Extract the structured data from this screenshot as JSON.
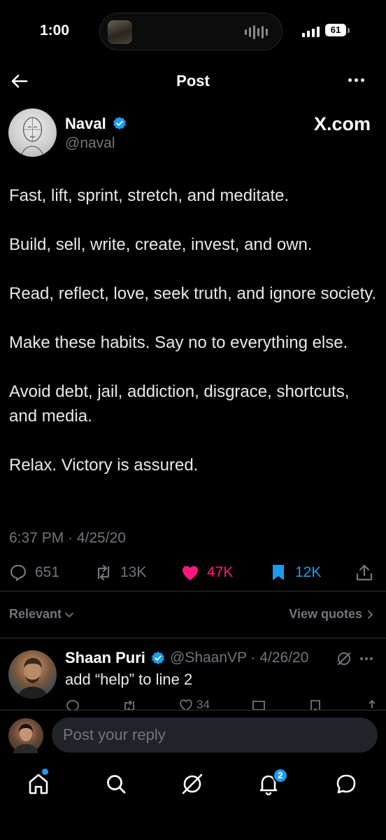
{
  "status_bar": {
    "time": "1:00",
    "battery": "61"
  },
  "header": {
    "title": "Post",
    "back_icon": "arrow-left-icon",
    "more_icon": "more-horizontal-icon"
  },
  "author": {
    "name": "Naval",
    "handle": "@naval",
    "verified": true,
    "watermark": "X.com"
  },
  "post": {
    "paragraphs": [
      "Fast, lift, sprint, stretch, and meditate.",
      "Build, sell, write, create, invest, and own.",
      "Read, reflect, love, seek truth, and ignore society.",
      "Make these habits. Say no to everything else.",
      "Avoid debt, jail, addiction, disgrace, shortcuts, and media.",
      "Relax. Victory is assured."
    ],
    "timestamp": "6:37 PM · 4/25/20"
  },
  "actions": {
    "replies": "651",
    "reposts": "13K",
    "likes": "47K",
    "bookmarks": "12K"
  },
  "sort": {
    "label": "Relevant",
    "view_quotes": "View quotes"
  },
  "reply": {
    "name": "Shaan Puri",
    "handle_date": "@ShaanVP · 4/26/20",
    "text": "add “help” to line 2",
    "likes": "34"
  },
  "composer": {
    "placeholder": "Post your reply"
  },
  "nav": {
    "notifications_badge": "2"
  },
  "colors": {
    "background": "#000000",
    "accent": "#1d9bf0",
    "like": "#f91880",
    "muted": "#71767b"
  }
}
